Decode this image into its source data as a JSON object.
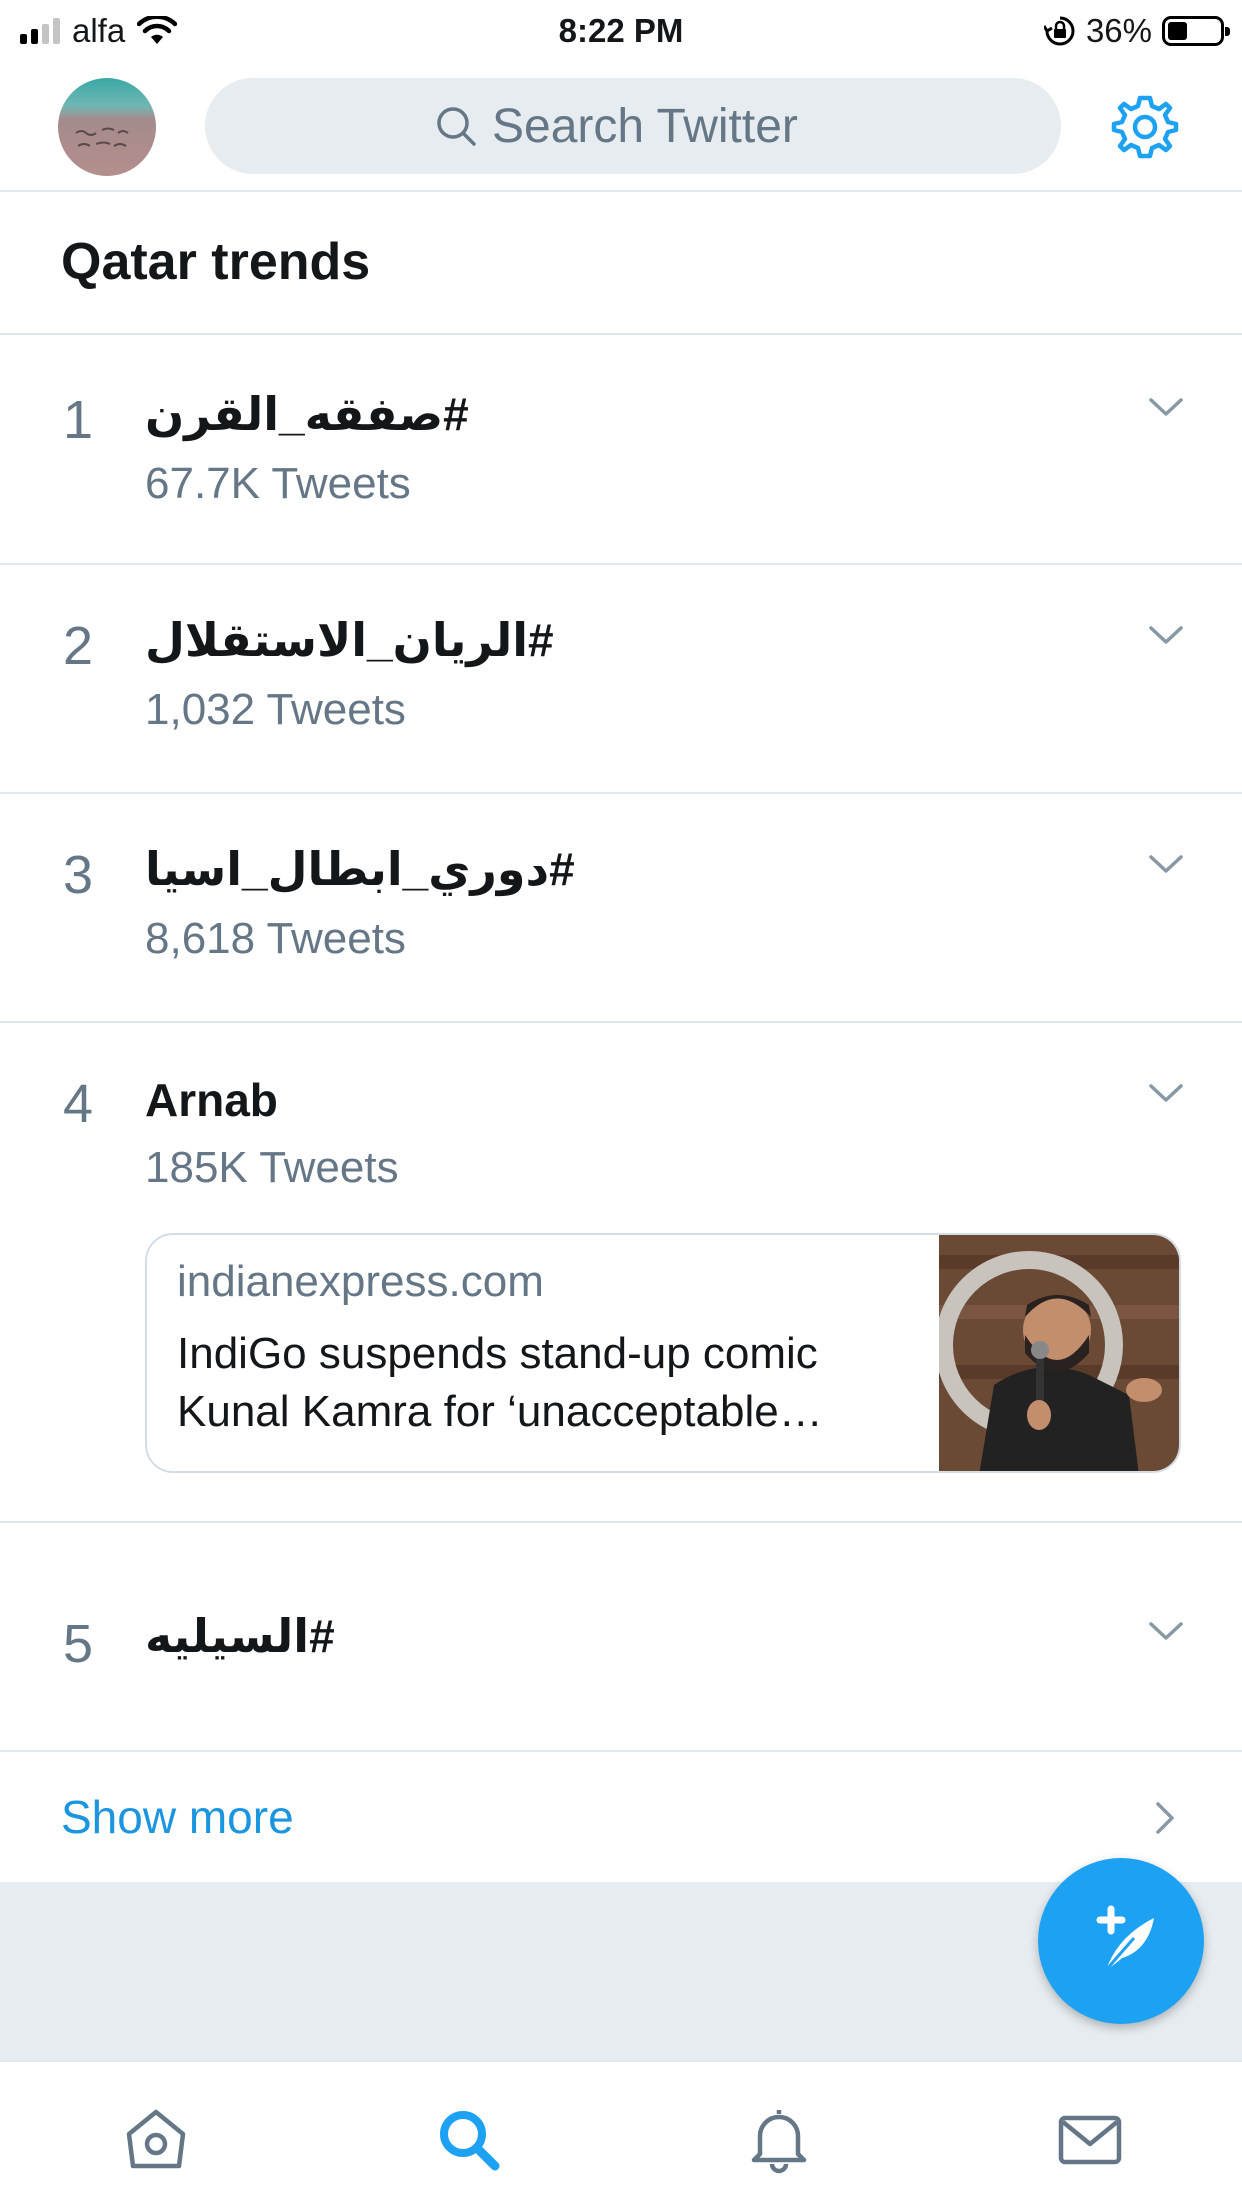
{
  "status_bar": {
    "carrier": "alfa",
    "time": "8:22 PM",
    "battery": "36%",
    "battery_level": 0.36,
    "icons": [
      "signal-icon",
      "wifi-icon",
      "rotation-lock-icon",
      "battery-icon"
    ]
  },
  "header": {
    "search_placeholder": "Search Twitter",
    "icons": [
      "avatar",
      "search-icon",
      "gear-icon"
    ],
    "accent_color": "#1da1f2"
  },
  "section": {
    "title": "Qatar trends"
  },
  "trends": [
    {
      "rank": "1",
      "name": "#صفقه_القرن",
      "count": "67.7K Tweets"
    },
    {
      "rank": "2",
      "name": "#الريان_الاستقلال",
      "count": "1,032 Tweets"
    },
    {
      "rank": "3",
      "name": "#دوري_ابطال_اسيا",
      "count": "8,618 Tweets"
    },
    {
      "rank": "4",
      "name": "Arnab",
      "count": "185K Tweets",
      "card": {
        "domain": "indianexpress.com",
        "headline": "IndiGo suspends stand-up comic Kunal Kamra for ‘unacceptable…"
      }
    },
    {
      "rank": "5",
      "name": "#السيليه"
    }
  ],
  "show_more": "Show more",
  "tabbar": {
    "icons": [
      "home-icon",
      "search-icon",
      "bell-icon",
      "mail-icon"
    ],
    "active": "search-icon"
  }
}
